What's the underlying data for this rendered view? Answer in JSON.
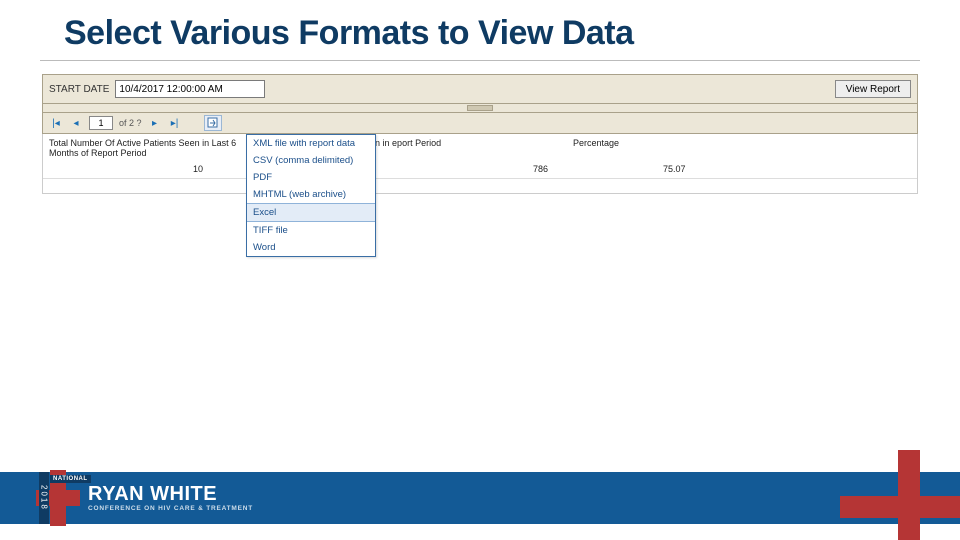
{
  "title": "Select Various Formats to View Data",
  "report_viewer": {
    "param_label": "START DATE",
    "param_value": "10/4/2017 12:00:00 AM",
    "view_report_button": "View Report",
    "toolbar": {
      "page_value": "1",
      "page_of": "of 2 ?"
    },
    "export_menu": [
      "XML file with report data",
      "CSV (comma delimited)",
      "PDF",
      "MHTML (web archive)",
      "Excel",
      "TIFF file",
      "Word"
    ],
    "export_selected_index": 4,
    "table": {
      "header1": "Total Number Of Active Patients Seen in Last 6 Months of Report Period",
      "header2": "ts Included Seen in eport Period",
      "header3": "Percentage",
      "value1": "10",
      "value2": "786",
      "value3": "75.07"
    }
  },
  "footer": {
    "year": "2018",
    "national": "NATIONAL",
    "line1": "RYAN WHITE",
    "line2": "CONFERENCE ON HIV CARE & TREATMENT"
  }
}
